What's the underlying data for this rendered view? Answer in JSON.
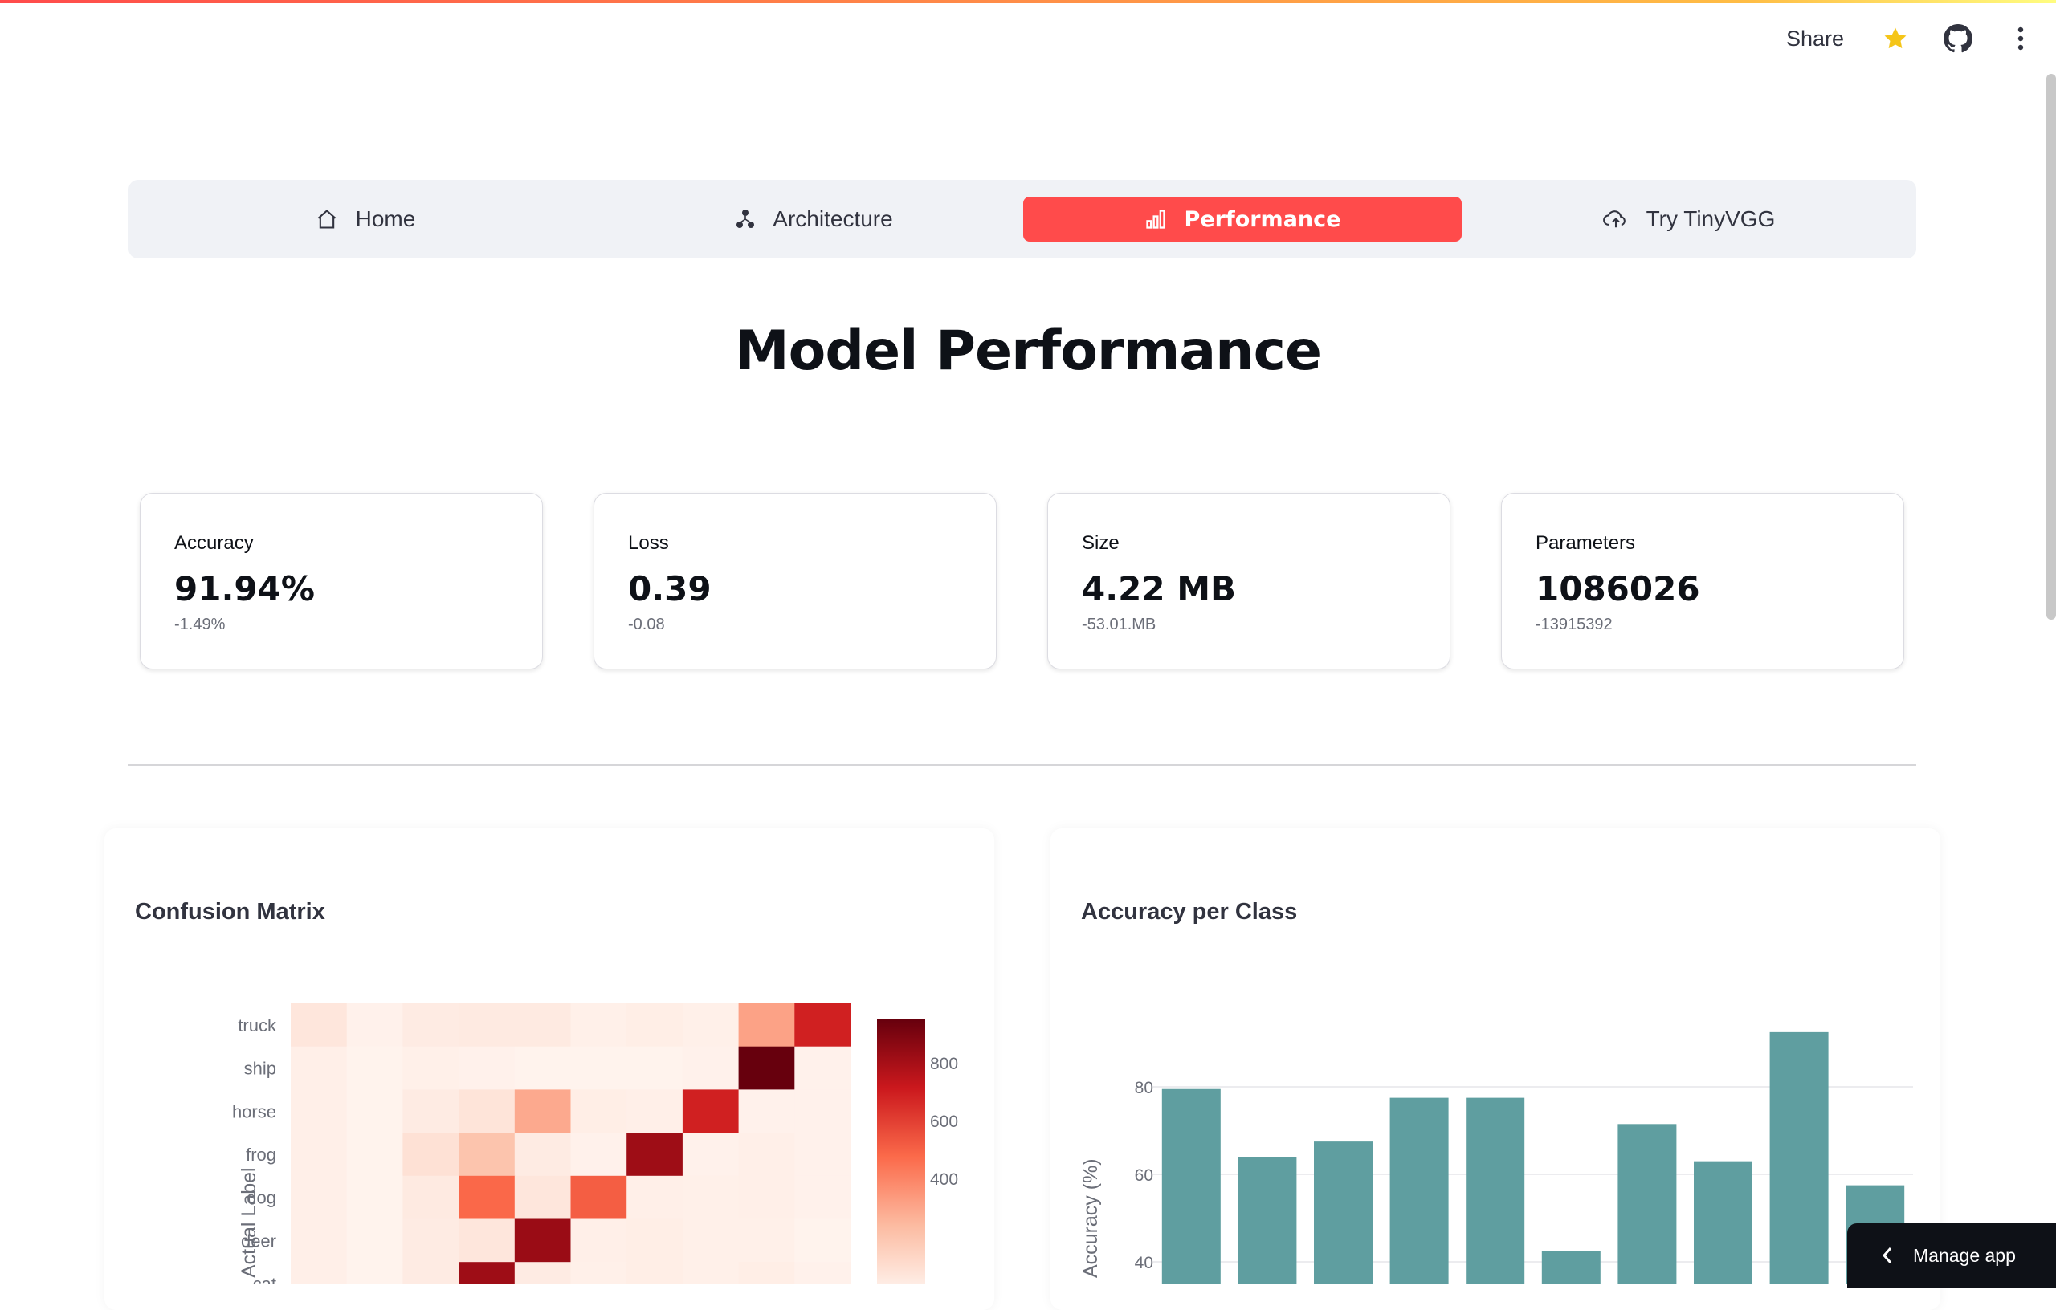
{
  "toolbar": {
    "share_label": "Share",
    "star_icon": "star-icon",
    "github_icon": "github-icon",
    "menu_icon": "more-vertical-icon"
  },
  "nav": {
    "items": [
      {
        "label": "Home",
        "icon": "home-icon"
      },
      {
        "label": "Architecture",
        "icon": "architecture-icon"
      },
      {
        "label": "Performance",
        "icon": "bar-chart-icon",
        "active": true
      },
      {
        "label": "Try TinyVGG",
        "icon": "cloud-upload-icon"
      }
    ],
    "active_color": "#ff4b4b"
  },
  "page_title": "Model Performance",
  "metrics": [
    {
      "label": "Accuracy",
      "value": "91.94%",
      "delta": "-1.49%"
    },
    {
      "label": "Loss",
      "value": "0.39",
      "delta": "-0.08"
    },
    {
      "label": "Size",
      "value": "4.22 MB",
      "delta": "-53.01.MB"
    },
    {
      "label": "Parameters",
      "value": "1086026",
      "delta": "-13915392"
    }
  ],
  "confusion_card": {
    "title": "Confusion Matrix"
  },
  "accuracy_card": {
    "title": "Accuracy per Class"
  },
  "manage_app": {
    "label": "Manage app"
  },
  "chart_data": [
    {
      "type": "heatmap",
      "title": "Confusion Matrix",
      "ylabel": "Actual Label",
      "y_categories_visible": [
        "truck",
        "ship",
        "horse",
        "frog",
        "dog",
        "deer",
        "cat"
      ],
      "colorbar_ticks": [
        400,
        600,
        800
      ],
      "colorbar_range": [
        0,
        950
      ],
      "colorscale": [
        "#fff5f0",
        "#fcbba1",
        "#fb6a4a",
        "#cb181d",
        "#67000d"
      ],
      "values": [
        [
          60,
          15,
          40,
          45,
          45,
          20,
          30,
          20,
          310,
          690
        ],
        [
          25,
          10,
          20,
          15,
          10,
          10,
          10,
          15,
          950,
          15
        ],
        [
          25,
          10,
          40,
          70,
          290,
          30,
          25,
          690,
          15,
          15
        ],
        [
          25,
          10,
          80,
          200,
          40,
          15,
          820,
          15,
          25,
          15
        ],
        [
          25,
          10,
          45,
          480,
          60,
          510,
          25,
          20,
          25,
          15
        ],
        [
          25,
          10,
          40,
          60,
          830,
          25,
          30,
          20,
          20,
          10
        ],
        [
          25,
          10,
          40,
          820,
          40,
          20,
          30,
          20,
          30,
          15
        ]
      ]
    },
    {
      "type": "bar",
      "title": "Accuracy per Class",
      "ylabel": "Accuracy (%)",
      "ylim": [
        30,
        100
      ],
      "yticks": [
        40,
        60,
        80
      ],
      "values": [
        79.5,
        64,
        67.5,
        77.5,
        77.5,
        42.5,
        71.5,
        63,
        92.5,
        57.5
      ],
      "color": "#5f9ea0",
      "grid": true
    }
  ]
}
